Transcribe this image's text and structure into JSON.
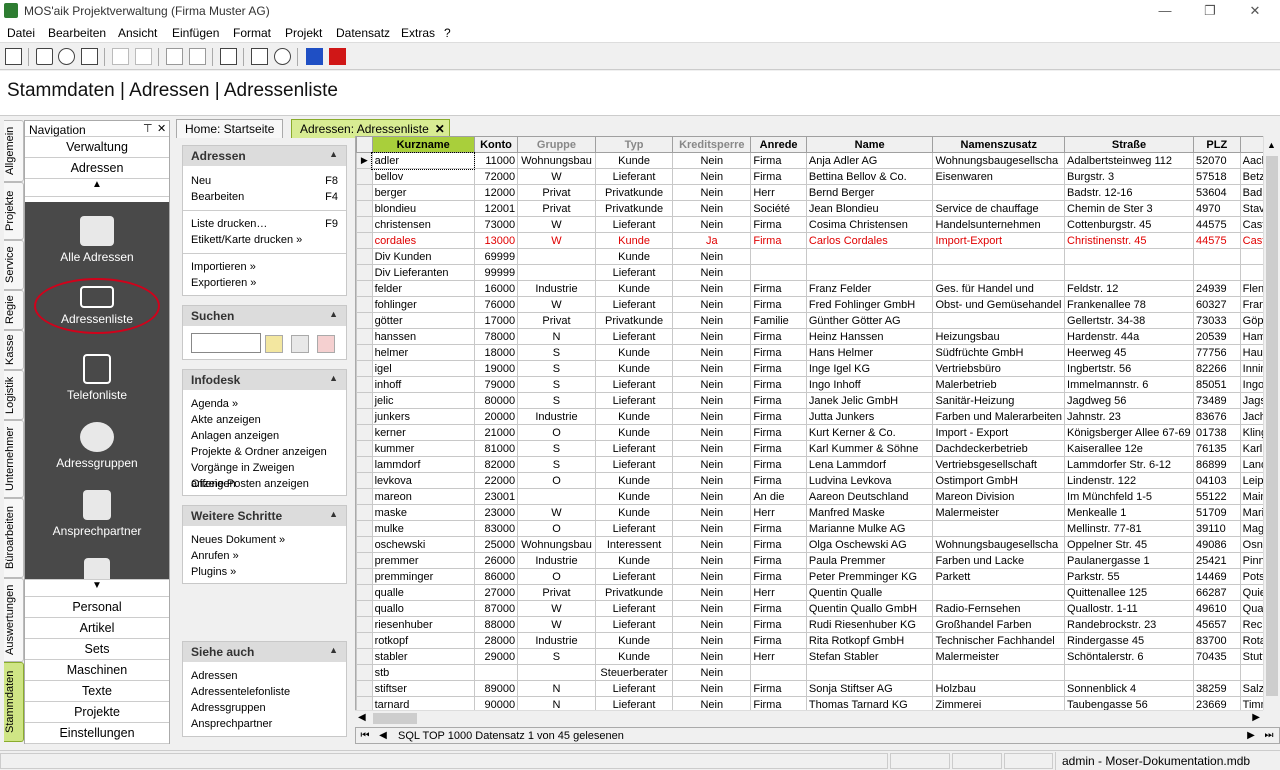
{
  "window": {
    "title": "MOS'aik Projektverwaltung (Firma Muster AG)",
    "min": "—",
    "restore": "❐",
    "close": "✕"
  },
  "menu": [
    "Datei",
    "Bearbeiten",
    "Ansicht",
    "Einfügen",
    "Format",
    "Projekt",
    "Datensatz",
    "Extras",
    "?"
  ],
  "path": "Stammdaten | Adressen | Adressenliste",
  "vtabs": [
    "Allgemein",
    "Projekte",
    "Service",
    "Regie",
    "Kasse",
    "Logistik",
    "Unternehmer",
    "Büroarbeiten",
    "Auswertungen",
    "Stammdaten"
  ],
  "nav": {
    "header": "Navigation",
    "pin": "⊤",
    "close": "✕",
    "top": [
      "Verwaltung",
      "Adressen"
    ],
    "tiles": [
      "Alle Adressen",
      "Adressenliste",
      "Telefonliste",
      "Adressgruppen",
      "Ansprechpartner"
    ],
    "bottom": [
      "Personal",
      "Artikel",
      "Sets",
      "Maschinen",
      "Texte",
      "Projekte",
      "Einstellungen"
    ],
    "up": "▲",
    "down": "▼"
  },
  "doctabs": [
    "Home: Startseite",
    "Adressen: Adressenliste"
  ],
  "doctab_close": "✕",
  "side": {
    "adressen": {
      "title": "Adressen",
      "links": [
        [
          "Neu",
          "F8"
        ],
        [
          "Bearbeiten",
          "F4"
        ],
        [
          "Liste drucken…",
          "F9"
        ],
        [
          "Etikett/Karte drucken »",
          ""
        ],
        [
          "Importieren »",
          ""
        ],
        [
          "Exportieren »",
          ""
        ]
      ]
    },
    "suchen": {
      "title": "Suchen",
      "placeholder": ""
    },
    "infodesk": {
      "title": "Infodesk",
      "links": [
        "Agenda »",
        "Akte anzeigen",
        "Anlagen anzeigen",
        "Projekte & Ordner anzeigen",
        "Vorgänge in Zweigen anzeigen",
        "Offene Posten anzeigen"
      ]
    },
    "weitere": {
      "title": "Weitere Schritte",
      "links": [
        "Neues Dokument »",
        "Anrufen »",
        "Plugins »"
      ]
    },
    "siehe": {
      "title": "Siehe auch",
      "links": [
        "Adressen",
        "Adressentelefonliste",
        "Adressgruppen",
        "Ansprechpartner"
      ]
    },
    "caret": "▲"
  },
  "grid": {
    "columns": [
      "Kurzname",
      "Konto",
      "Gruppe",
      "Typ",
      "Kreditsperre",
      "Anrede",
      "Name",
      "Namenszusatz",
      "Straße",
      "PLZ",
      ""
    ],
    "rows": [
      [
        "adler",
        "11000",
        "Wohnungsbau",
        "Kunde",
        "Nein",
        "Firma",
        "Anja Adler AG",
        "Wohnungsbaugesellscha",
        "Adalbertsteinweg 112",
        "52070",
        "Aach"
      ],
      [
        "bellov",
        "72000",
        "W",
        "Lieferant",
        "Nein",
        "Firma",
        "Bettina Bellov & Co.",
        "Eisenwaren",
        "Burgstr. 3",
        "57518",
        "Betz"
      ],
      [
        "berger",
        "12000",
        "Privat",
        "Privatkunde",
        "Nein",
        "Herr",
        "Bernd Berger",
        "",
        "Badstr. 12-16",
        "53604",
        "Bad"
      ],
      [
        "blondieu",
        "12001",
        "Privat",
        "Privatkunde",
        "Nein",
        "Société",
        "Jean Blondieu",
        "Service de chauffage",
        "Chemin de Ster 3",
        "4970",
        "Stav"
      ],
      [
        "christensen",
        "73000",
        "W",
        "Lieferant",
        "Nein",
        "Firma",
        "Cosima Christensen",
        "Handelsunternehmen",
        "Cottenburgstr. 45",
        "44575",
        "Cast"
      ],
      [
        "cordales",
        "13000",
        "W",
        "Kunde",
        "Ja",
        "Firma",
        "Carlos Cordales",
        "Import-Export",
        "Christinenstr. 45",
        "44575",
        "Cast"
      ],
      [
        "Div Kunden",
        "69999",
        "",
        "Kunde",
        "Nein",
        "",
        "",
        "",
        "",
        "",
        ""
      ],
      [
        "Div Lieferanten",
        "99999",
        "",
        "Lieferant",
        "Nein",
        "",
        "",
        "",
        "",
        "",
        ""
      ],
      [
        "felder",
        "16000",
        "Industrie",
        "Kunde",
        "Nein",
        "Firma",
        "Franz Felder",
        "Ges. für Handel und",
        "Feldstr. 12",
        "24939",
        "Flens"
      ],
      [
        "fohlinger",
        "76000",
        "W",
        "Lieferant",
        "Nein",
        "Firma",
        "Fred Fohlinger GmbH",
        "Obst- und Gemüsehandel",
        "Frankenallee 78",
        "60327",
        "Fran"
      ],
      [
        "götter",
        "17000",
        "Privat",
        "Privatkunde",
        "Nein",
        "Familie",
        "Günther Götter AG",
        "",
        "Gellertstr. 34-38",
        "73033",
        "Göpp"
      ],
      [
        "hanssen",
        "78000",
        "N",
        "Lieferant",
        "Nein",
        "Firma",
        "Heinz Hanssen",
        "Heizungsbau",
        "Hardenstr. 44a",
        "20539",
        "Ham"
      ],
      [
        "helmer",
        "18000",
        "S",
        "Kunde",
        "Nein",
        "Firma",
        "Hans Helmer",
        "Südfrüchte GmbH",
        "Heerweg 45",
        "77756",
        "Haus"
      ],
      [
        "igel",
        "19000",
        "S",
        "Kunde",
        "Nein",
        "Firma",
        "Inge Igel KG",
        "Vertriebsbüro",
        "Ingbertstr. 56",
        "82266",
        "Innin"
      ],
      [
        "inhoff",
        "79000",
        "S",
        "Lieferant",
        "Nein",
        "Firma",
        "Ingo Inhoff",
        "Malerbetrieb",
        "Immelmannstr. 6",
        "85051",
        "Ingol"
      ],
      [
        "jelic",
        "80000",
        "S",
        "Lieferant",
        "Nein",
        "Firma",
        "Janek Jelic GmbH",
        "Sanitär-Heizung",
        "Jagdweg 56",
        "73489",
        "Jags"
      ],
      [
        "junkers",
        "20000",
        "Industrie",
        "Kunde",
        "Nein",
        "Firma",
        "Jutta Junkers",
        "Farben und Malerarbeiten",
        "Jahnstr. 23",
        "83676",
        "Jach"
      ],
      [
        "kerner",
        "21000",
        "O",
        "Kunde",
        "Nein",
        "Firma",
        "Kurt Kerner & Co.",
        "Import - Export",
        "Königsberger Allee 67-69",
        "01738",
        "Kling"
      ],
      [
        "kummer",
        "81000",
        "S",
        "Lieferant",
        "Nein",
        "Firma",
        "Karl Kummer & Söhne",
        "Dachdeckerbetrieb",
        "Kaiserallee 12e",
        "76135",
        "Karl"
      ],
      [
        "lammdorf",
        "82000",
        "S",
        "Lieferant",
        "Nein",
        "Firma",
        "Lena Lammdorf",
        "Vertriebsgesellschaft",
        "Lammdorfer Str. 6-12",
        "86899",
        "Land"
      ],
      [
        "levkova",
        "22000",
        "O",
        "Kunde",
        "Nein",
        "Firma",
        "Ludvina Levkova",
        "Ostimport GmbH",
        "Lindenstr. 122",
        "04103",
        "Leipz"
      ],
      [
        "mareon",
        "23001",
        "",
        "Kunde",
        "Nein",
        "An die",
        "Aareon Deutschland",
        "Mareon Division",
        "Im Münchfeld 1-5",
        "55122",
        "Main"
      ],
      [
        "maske",
        "23000",
        "W",
        "Kunde",
        "Nein",
        "Herr",
        "Manfred Maske",
        "Malermeister",
        "Menkealle 1",
        "51709",
        "Marie"
      ],
      [
        "mulke",
        "83000",
        "O",
        "Lieferant",
        "Nein",
        "Firma",
        "Marianne Mulke AG",
        "",
        "Mellinstr. 77-81",
        "39110",
        "Mage"
      ],
      [
        "oschewski",
        "25000",
        "Wohnungsbau",
        "Interessent",
        "Nein",
        "Firma",
        "Olga Oschewski AG",
        "Wohnungsbaugesellscha",
        "Oppelner Str. 45",
        "49086",
        "Osna"
      ],
      [
        "premmer",
        "26000",
        "Industrie",
        "Kunde",
        "Nein",
        "Firma",
        "Paula Premmer",
        "Farben und Lacke",
        "Paulanergasse 1",
        "25421",
        "Pinn"
      ],
      [
        "premminger",
        "86000",
        "O",
        "Lieferant",
        "Nein",
        "Firma",
        "Peter Premminger KG",
        "Parkett",
        "Parkstr. 55",
        "14469",
        "Pots"
      ],
      [
        "qualle",
        "27000",
        "Privat",
        "Privatkunde",
        "Nein",
        "Herr",
        "Quentin Qualle",
        "",
        "Quittenallee 125",
        "66287",
        "Quie"
      ],
      [
        "quallo",
        "87000",
        "W",
        "Lieferant",
        "Nein",
        "Firma",
        "Quentin Quallo GmbH",
        "Radio-Fernsehen",
        "Quallostr. 1-11",
        "49610",
        "Quak"
      ],
      [
        "riesenhuber",
        "88000",
        "W",
        "Lieferant",
        "Nein",
        "Firma",
        "Rudi Riesenhuber KG",
        "Großhandel Farben",
        "Randebrockstr. 23",
        "45657",
        "Reck"
      ],
      [
        "rotkopf",
        "28000",
        "Industrie",
        "Kunde",
        "Nein",
        "Firma",
        "Rita Rotkopf GmbH",
        "Technischer Fachhandel",
        "Rindergasse 45",
        "83700",
        "Rota"
      ],
      [
        "stabler",
        "29000",
        "S",
        "Kunde",
        "Nein",
        "Herr",
        "Stefan Stabler",
        "Malermeister",
        "Schöntalerstr. 6",
        "70435",
        "Stutt"
      ],
      [
        "stb",
        "",
        "",
        "Steuerberater",
        "Nein",
        "",
        "",
        "",
        "",
        "",
        ""
      ],
      [
        "stiftser",
        "89000",
        "N",
        "Lieferant",
        "Nein",
        "Firma",
        "Sonja Stiftser AG",
        "Holzbau",
        "Sonnenblick 4",
        "38259",
        "Salz"
      ],
      [
        "tarnard",
        "90000",
        "N",
        "Lieferant",
        "Nein",
        "Firma",
        "Thomas Tarnard KG",
        "Zimmerei",
        "Taubengasse 56",
        "23669",
        "Timm"
      ]
    ],
    "red_row": 5,
    "current_marker": "▶"
  },
  "navigator": {
    "status": "SQL TOP 1000 Datensatz 1 von 45 gelesenen",
    "first": "⏮",
    "prev": "◀",
    "next": "▶",
    "last": "⏭"
  },
  "status": {
    "user": "admin - Moser-Dokumentation.mdb"
  }
}
